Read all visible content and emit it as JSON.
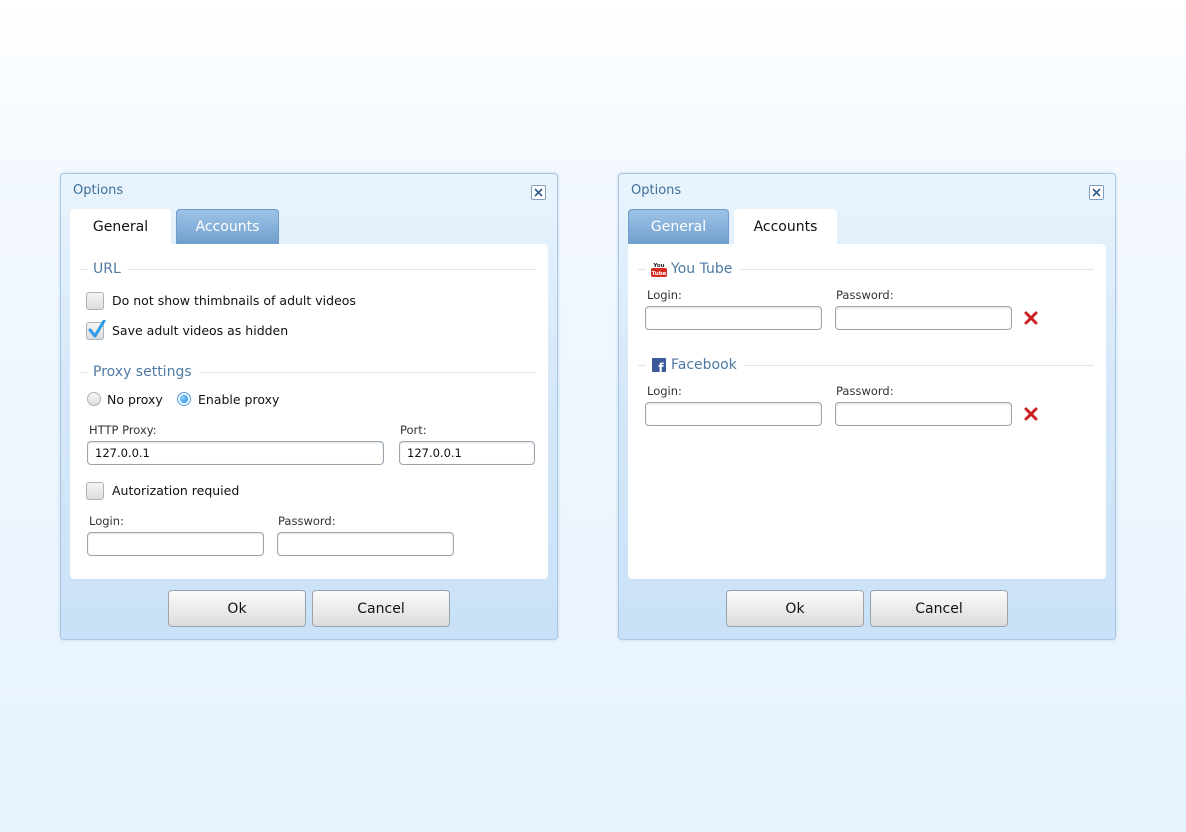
{
  "dialogs": [
    {
      "title": "Options",
      "tabs": [
        {
          "label": "General",
          "active": true
        },
        {
          "label": "Accounts",
          "active": false
        }
      ],
      "url_section": {
        "title": "URL",
        "options": [
          {
            "label": "Do not show thimbnails of adult videos",
            "checked": false
          },
          {
            "label": "Save adult videos as hidden",
            "checked": true
          }
        ]
      },
      "proxy_section": {
        "title": "Proxy settings",
        "mode_options": [
          {
            "label": "No proxy",
            "selected": false
          },
          {
            "label": "Enable proxy",
            "selected": true
          }
        ],
        "http_proxy_label": "HTTP Proxy:",
        "http_proxy_value": "127.0.0.1",
        "port_label": "Port:",
        "port_value": "127.0.0.1",
        "auth_label": "Autorization requied",
        "auth_checked": false,
        "login_label": "Login:",
        "login_value": "",
        "password_label": "Password:",
        "password_value": ""
      },
      "buttons": {
        "ok": "Ok",
        "cancel": "Cancel"
      }
    },
    {
      "title": "Options",
      "tabs": [
        {
          "label": "General",
          "active": false
        },
        {
          "label": "Accounts",
          "active": true
        }
      ],
      "accounts": [
        {
          "service": "You Tube",
          "icon": "youtube-icon",
          "icon_text_top": "You",
          "icon_text_bottom": "Tube",
          "login_label": "Login:",
          "login_value": "",
          "password_label": "Password:",
          "password_value": ""
        },
        {
          "service": "Facebook",
          "icon": "facebook-icon",
          "icon_text": "f",
          "login_label": "Login:",
          "login_value": "",
          "password_label": "Password:",
          "password_value": ""
        }
      ],
      "buttons": {
        "ok": "Ok",
        "cancel": "Cancel"
      }
    }
  ],
  "colors": {
    "accent": "#4e7aa3",
    "tab_inactive": "#6f9fcd",
    "remove": "#cc1f1f",
    "youtube_red": "#d62a1e",
    "facebook_blue": "#3b5998"
  }
}
